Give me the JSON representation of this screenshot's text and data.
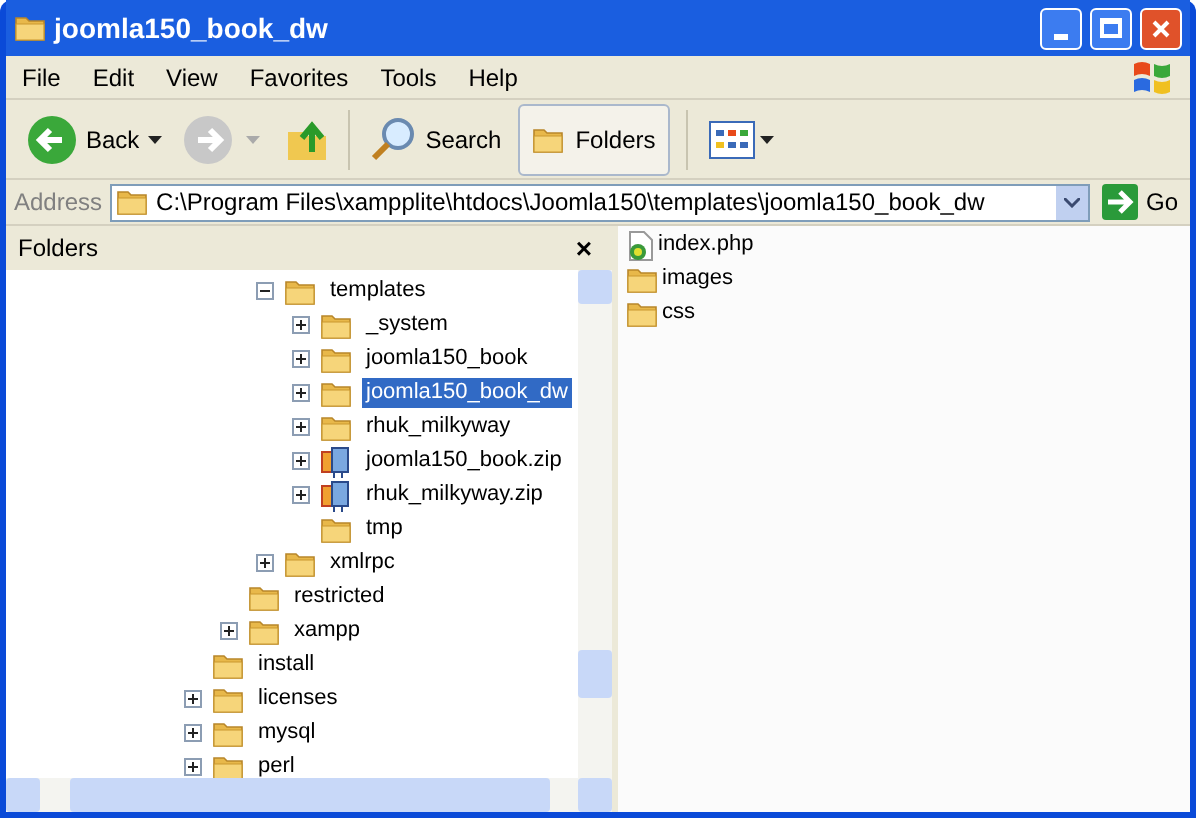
{
  "window": {
    "title": "joomla150_book_dw"
  },
  "menu": [
    "File",
    "Edit",
    "View",
    "Favorites",
    "Tools",
    "Help"
  ],
  "toolbar": {
    "back": "Back",
    "search": "Search",
    "folders": {
      "label": "Folders",
      "selected": true
    }
  },
  "address": {
    "label": "Address",
    "value": "C:\\Program Files\\xampplite\\htdocs\\Joomla150\\templates\\joomla150_book_dw",
    "go": "Go"
  },
  "folders_pane": {
    "title": "Folders",
    "close": "×"
  },
  "tree": [
    {
      "children": [
        {
          "children": [
            {
              "label": "templates",
              "kind": "folder",
              "expanded": true,
              "selected": false,
              "children": [
                {
                  "label": "_system",
                  "kind": "folder",
                  "expanded": false,
                  "selected": false
                },
                {
                  "label": "joomla150_book",
                  "kind": "folder",
                  "expanded": false,
                  "selected": false
                },
                {
                  "label": "joomla150_book_dw",
                  "kind": "folder",
                  "expanded": false,
                  "selected": true
                },
                {
                  "label": "rhuk_milkyway",
                  "kind": "folder",
                  "expanded": false,
                  "selected": false
                },
                {
                  "label": "joomla150_book.zip",
                  "kind": "zip",
                  "expanded": false,
                  "selected": false
                },
                {
                  "label": "rhuk_milkyway.zip",
                  "kind": "zip",
                  "expanded": false,
                  "selected": false
                },
                {
                  "label": "tmp",
                  "kind": "folder",
                  "selected": false
                }
              ]
            },
            {
              "label": "xmlrpc",
              "kind": "folder",
              "expanded": false,
              "selected": false
            }
          ]
        },
        {
          "label": "restricted",
          "kind": "folder",
          "selected": false
        },
        {
          "label": "xampp",
          "kind": "folder",
          "expanded": false,
          "selected": false
        }
      ]
    },
    {
      "label": "install",
      "kind": "folder",
      "selected": false
    },
    {
      "label": "licenses",
      "kind": "folder",
      "expanded": false,
      "selected": false
    },
    {
      "label": "mysql",
      "kind": "folder",
      "expanded": false,
      "selected": false
    },
    {
      "label": "perl",
      "kind": "folder",
      "expanded": false,
      "selected": false
    }
  ],
  "files": [
    {
      "name": "index.php",
      "kind": "php"
    },
    {
      "name": "images",
      "kind": "folder"
    },
    {
      "name": "css",
      "kind": "folder"
    }
  ]
}
